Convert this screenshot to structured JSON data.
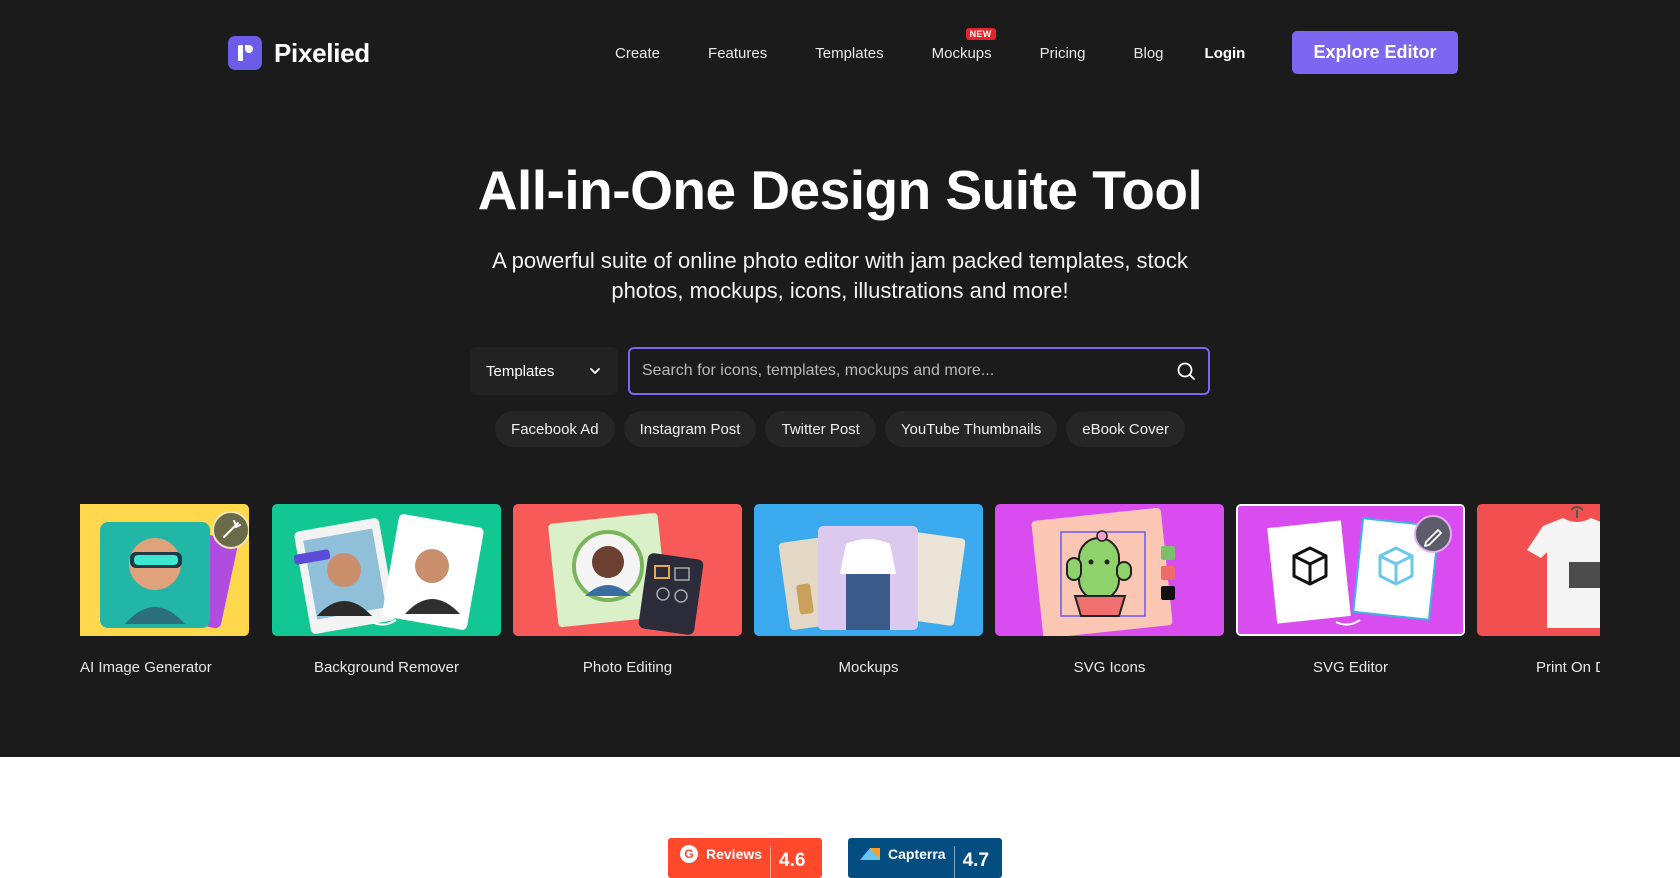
{
  "brand": {
    "name": "Pixelied"
  },
  "nav": {
    "links": [
      "Create",
      "Features",
      "Templates",
      "Mockups",
      "Pricing",
      "Blog"
    ],
    "new_badge": "NEW",
    "login": "Login",
    "cta": "Explore Editor"
  },
  "hero": {
    "title": "All-in-One Design Suite Tool",
    "subtitle": "A powerful suite of online photo editor with jam packed templates, stock photos, mockups, icons, illustrations and more!"
  },
  "search": {
    "category": "Templates",
    "placeholder": "Search for icons, templates, mockups and more..."
  },
  "chips": [
    "Facebook Ad",
    "Instagram Post",
    "Twitter Post",
    "YouTube Thumbnails",
    "eBook Cover"
  ],
  "cards": [
    {
      "label": "AI Image Generator",
      "color": "#ffd84d"
    },
    {
      "label": "Background Remover",
      "color": "#12c791"
    },
    {
      "label": "Photo Editing",
      "color": "#f85a5a"
    },
    {
      "label": "Mockups",
      "color": "#3aa9ee"
    },
    {
      "label": "SVG Icons",
      "color": "#d94df0"
    },
    {
      "label": "SVG Editor",
      "color": "#d94df0"
    },
    {
      "label": "Print On D",
      "color": "#f25050"
    }
  ],
  "ratings": [
    {
      "name": "Reviews",
      "score": "4.6",
      "color": "#ff492c"
    },
    {
      "name": "Capterra",
      "score": "4.7",
      "color": "#044d80"
    }
  ],
  "colors": {
    "accent": "#7d67f0",
    "hero_bg": "#1b1b1b"
  }
}
